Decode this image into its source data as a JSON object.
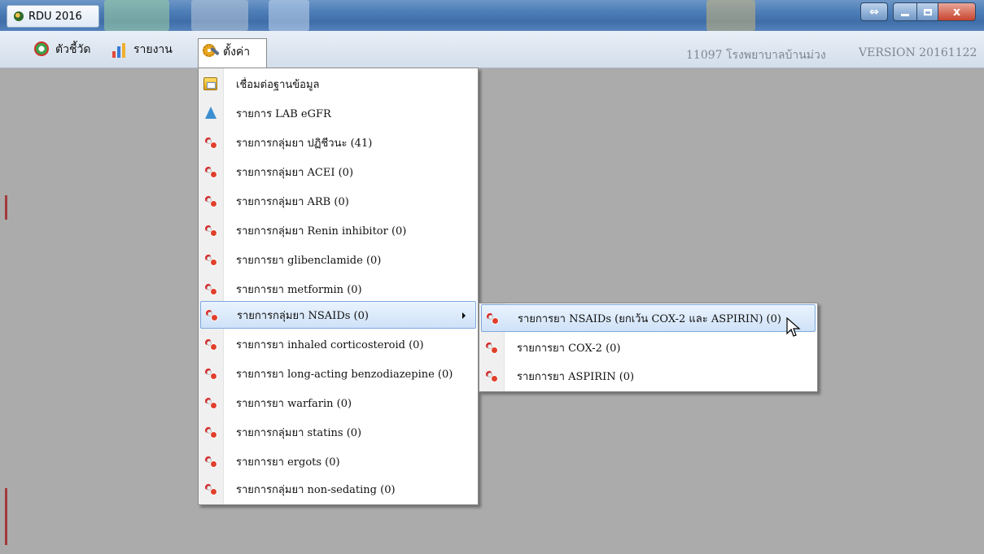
{
  "window": {
    "title": "RDU 2016",
    "resize_glyph": "⇔",
    "close_glyph": "x"
  },
  "menubar": {
    "items": [
      {
        "label": "ตัวชี้วัด",
        "icon": "gauge-icon"
      },
      {
        "label": "รายงาน",
        "icon": "chart-icon"
      },
      {
        "label": "ตั้งค่า",
        "icon": "settings-gear-icon"
      }
    ],
    "hospital": "11097 โรงพยาบาลบ้านม่วง",
    "version": "VERSION 20161122"
  },
  "settings_menu": {
    "items": [
      {
        "label": "เชื่อมต่อฐานข้อมูล",
        "icon": "database-icon"
      },
      {
        "label": "รายการ LAB eGFR",
        "icon": "flask-icon"
      },
      {
        "label": "รายการกลุ่มยา ปฏิชีวนะ (41)",
        "icon": "pill-icon"
      },
      {
        "label": "รายการกลุ่มยา ACEI (0)",
        "icon": "pill-icon"
      },
      {
        "label": "รายการกลุ่มยา ARB (0)",
        "icon": "pill-icon"
      },
      {
        "label": "รายการกลุ่มยา Renin inhibitor (0)",
        "icon": "pill-icon"
      },
      {
        "label": "รายการยา glibenclamide (0)",
        "icon": "pill-icon"
      },
      {
        "label": "รายการยา metformin (0)",
        "icon": "pill-icon"
      },
      {
        "label": "รายการกลุ่มยา NSAIDs (0)",
        "icon": "pill-icon"
      },
      {
        "label": "รายการยา inhaled corticosteroid (0)",
        "icon": "pill-icon"
      },
      {
        "label": "รายการยา long-acting benzodiazepine (0)",
        "icon": "pill-icon"
      },
      {
        "label": "รายการยา warfarin (0)",
        "icon": "pill-icon"
      },
      {
        "label": "รายการกลุ่มยา statins (0)",
        "icon": "pill-icon"
      },
      {
        "label": "รายการยา ergots (0)",
        "icon": "pill-icon"
      },
      {
        "label": "รายการกลุ่มยา non-sedating (0)",
        "icon": "pill-icon"
      }
    ]
  },
  "nsaids_submenu": {
    "items": [
      {
        "label": "รายการยา NSAIDs (ยกเว้น COX-2 และ ASPIRIN) (0)",
        "icon": "pill-icon"
      },
      {
        "label": "รายการยา COX-2 (0)",
        "icon": "pill-icon"
      },
      {
        "label": "รายการยา ASPIRIN (0)",
        "icon": "pill-icon"
      }
    ]
  },
  "colors": {
    "desktop": "#ababab",
    "highlight_border": "#7fa9dc",
    "pill_red": "#d52a2a"
  }
}
